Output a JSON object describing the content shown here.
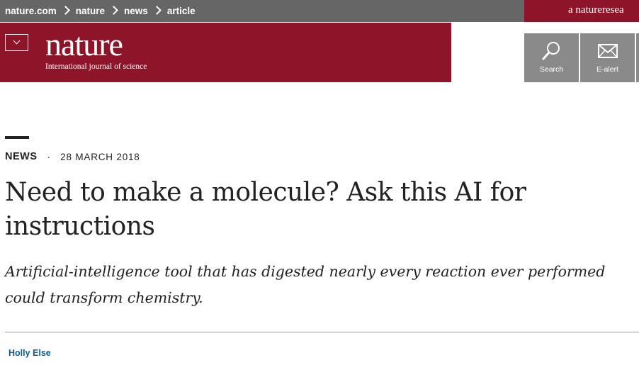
{
  "breadcrumb": [
    "nature.com",
    "nature",
    "news",
    "article"
  ],
  "research_brand": "a natureresea",
  "masthead": {
    "logo": "nature",
    "tagline": "International journal of science"
  },
  "tools": {
    "search_label": "Search",
    "ealert_label": "E-alert"
  },
  "article": {
    "type": "NEWS",
    "separator": "·",
    "date": "28 MARCH 2018",
    "title": "Need to make a molecule? Ask this AI for instructions",
    "standfirst": "Artificial-intelligence tool that has digested nearly every reaction ever performed could transform chemistry.",
    "author": "Holly Else"
  },
  "colors": {
    "brand": "#8e1429",
    "topbar": "#666666",
    "tool_bg": "#8a8a8a",
    "author_link": "#0b5d8f"
  }
}
